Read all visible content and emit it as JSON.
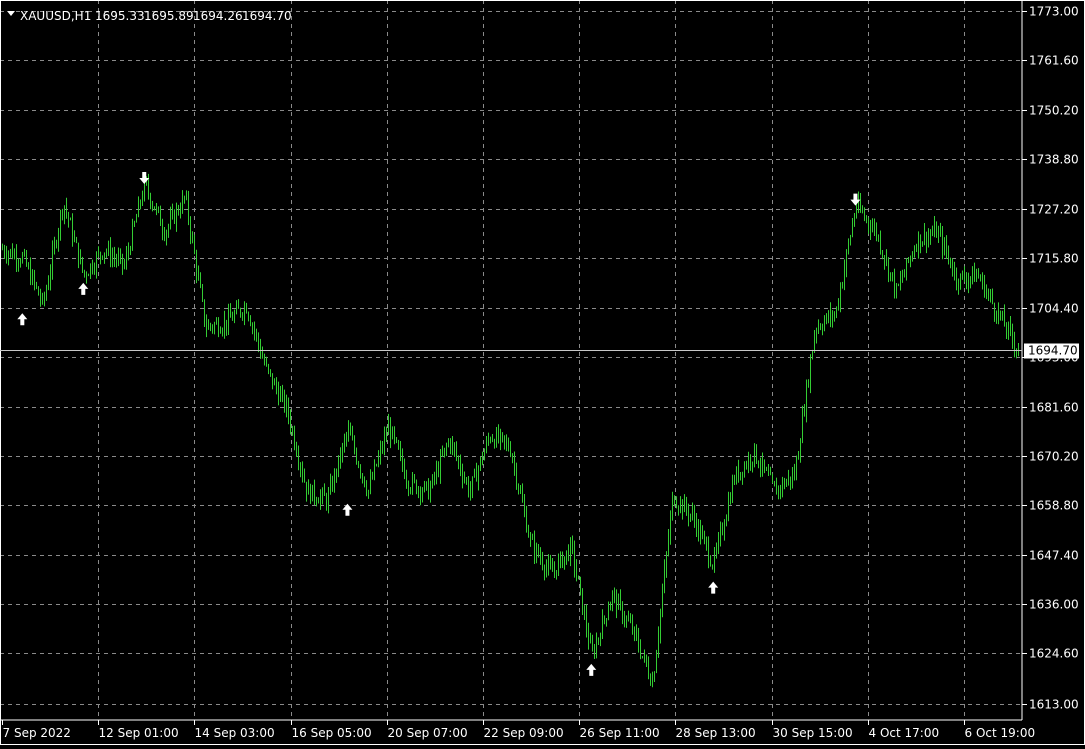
{
  "header": {
    "symbol": "XAUUSD,H1",
    "open": "1695.33",
    "high": "1695.89",
    "low": "1694.26",
    "close": "1694.70"
  },
  "colors": {
    "background": "#000000",
    "bars": "#33cc33",
    "grid": "#8a8a8a",
    "axis": "#ffffff",
    "arrows": "#ffffff",
    "price_label_bg": "#ffffff",
    "price_label_text": "#000000"
  },
  "chart_data": {
    "type": "bar",
    "timeframe": "H1",
    "ylim": [
      1609.2,
      1775.5
    ],
    "grid": true,
    "yticks": [
      "1773.00",
      "1761.60",
      "1750.20",
      "1738.80",
      "1727.20",
      "1715.80",
      "1704.40",
      "1693.00",
      "1681.60",
      "1670.20",
      "1658.80",
      "1647.40",
      "1636.00",
      "1624.60",
      "1613.00"
    ],
    "xticks": [
      "7 Sep 2022",
      "12 Sep 01:00",
      "14 Sep 03:00",
      "16 Sep 05:00",
      "20 Sep 07:00",
      "22 Sep 09:00",
      "26 Sep 11:00",
      "28 Sep 13:00",
      "30 Sep 15:00",
      "4 Oct 17:00",
      "6 Oct 19:00"
    ],
    "current_price": "1694.70",
    "price_path": [
      {
        "t": "7 Sep 2022",
        "p": 1718
      },
      {
        "t": "8 Sep",
        "p": 1716
      },
      {
        "t": "8 Sep",
        "p": 1705
      },
      {
        "t": "8 Sep",
        "p": 1729
      },
      {
        "t": "9 Sep",
        "p": 1712
      },
      {
        "t": "9 Sep",
        "p": 1718
      },
      {
        "t": "12 Sep 01:00",
        "p": 1714
      },
      {
        "t": "12 Sep",
        "p": 1733
      },
      {
        "t": "12 Sep",
        "p": 1722
      },
      {
        "t": "13 Sep",
        "p": 1730
      },
      {
        "t": "13 Sep",
        "p": 1700
      },
      {
        "t": "14 Sep 03:00",
        "p": 1701
      },
      {
        "t": "14 Sep",
        "p": 1705
      },
      {
        "t": "14 Sep",
        "p": 1690
      },
      {
        "t": "15 Sep",
        "p": 1681
      },
      {
        "t": "15 Sep",
        "p": 1662
      },
      {
        "t": "16 Sep 05:00",
        "p": 1660
      },
      {
        "t": "16 Sep",
        "p": 1676
      },
      {
        "t": "19 Sep",
        "p": 1662
      },
      {
        "t": "19 Sep",
        "p": 1677
      },
      {
        "t": "20 Sep 07:00",
        "p": 1664
      },
      {
        "t": "20 Sep",
        "p": 1662
      },
      {
        "t": "21 Sep",
        "p": 1674
      },
      {
        "t": "21 Sep",
        "p": 1662
      },
      {
        "t": "22 Sep",
        "p": 1675
      },
      {
        "t": "22 Sep 09:00",
        "p": 1672
      },
      {
        "t": "23 Sep",
        "p": 1650
      },
      {
        "t": "23 Sep",
        "p": 1643
      },
      {
        "t": "26 Sep",
        "p": 1649
      },
      {
        "t": "26 Sep 11:00",
        "p": 1624
      },
      {
        "t": "27 Sep",
        "p": 1638
      },
      {
        "t": "27 Sep",
        "p": 1630
      },
      {
        "t": "28 Sep",
        "p": 1618
      },
      {
        "t": "28 Sep",
        "p": 1661
      },
      {
        "t": "28 Sep 13:00",
        "p": 1656
      },
      {
        "t": "29 Sep",
        "p": 1645
      },
      {
        "t": "29 Sep",
        "p": 1665
      },
      {
        "t": "30 Sep",
        "p": 1671
      },
      {
        "t": "30 Sep",
        "p": 1662
      },
      {
        "t": "30 Sep 15:00",
        "p": 1666
      },
      {
        "t": "3 Oct",
        "p": 1700
      },
      {
        "t": "3 Oct",
        "p": 1703
      },
      {
        "t": "4 Oct",
        "p": 1728
      },
      {
        "t": "4 Oct 17:00",
        "p": 1722
      },
      {
        "t": "5 Oct",
        "p": 1708
      },
      {
        "t": "5 Oct",
        "p": 1720
      },
      {
        "t": "5 Oct",
        "p": 1722
      },
      {
        "t": "6 Oct",
        "p": 1711
      },
      {
        "t": "6 Oct 19:00",
        "p": 1712
      },
      {
        "t": "7 Oct",
        "p": 1703
      },
      {
        "t": "7 Oct",
        "p": 1694.7
      }
    ],
    "fractals": [
      {
        "dir": "up",
        "t": "8 Sep",
        "price": 1705
      },
      {
        "dir": "up",
        "t": "9 Sep",
        "price": 1712
      },
      {
        "dir": "down",
        "t": "12 Sep",
        "price": 1733
      },
      {
        "dir": "up",
        "t": "16 Sep",
        "price": 1661
      },
      {
        "dir": "up",
        "t": "26 Sep 11:00",
        "price": 1624
      },
      {
        "dir": "up",
        "t": "29 Sep",
        "price": 1643
      },
      {
        "dir": "down",
        "t": "4 Oct",
        "price": 1728
      }
    ]
  }
}
